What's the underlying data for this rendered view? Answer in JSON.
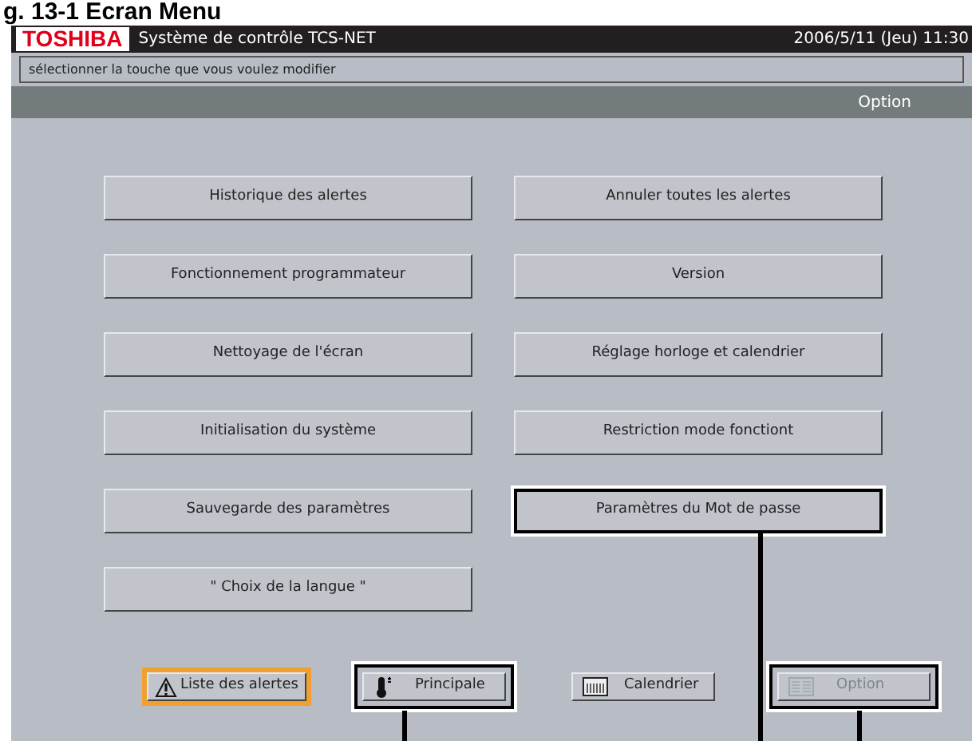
{
  "figure_caption": "g. 13-1 Ecran Menu",
  "header": {
    "logo": "TOSHIBA",
    "title": "Système de contrôle TCS-NET",
    "datetime": "2006/5/11 (Jeu) 11:30"
  },
  "message": "sélectionner la touche que vous voulez modifier",
  "section_title": "Option",
  "menu_buttons": [
    {
      "label": "Historique des alertes",
      "callout": false
    },
    {
      "label": "Annuler toutes les alertes",
      "callout": false
    },
    {
      "label": "Fonctionnement programmateur",
      "callout": false
    },
    {
      "label": "Version",
      "callout": false
    },
    {
      "label": "Nettoyage de l'écran",
      "callout": false
    },
    {
      "label": "Réglage horloge et calendrier",
      "callout": false
    },
    {
      "label": "Initialisation du système",
      "callout": false
    },
    {
      "label": "Restriction mode fonctiont",
      "callout": false
    },
    {
      "label": "Sauvegarde des paramètres",
      "callout": false
    },
    {
      "label": "Paramètres du Mot de passe",
      "callout": true
    },
    {
      "label": "\" Choix de la langue \"",
      "callout": false
    }
  ],
  "nav_buttons": [
    {
      "kind": "alert",
      "label": "Liste des alertes",
      "alert": true,
      "disabled": false,
      "callout": false
    },
    {
      "kind": "main",
      "label": "Principale",
      "alert": false,
      "disabled": false,
      "callout": true
    },
    {
      "kind": "calendar",
      "label": "Calendrier",
      "alert": false,
      "disabled": false,
      "callout": false
    },
    {
      "kind": "option",
      "label": "Option",
      "alert": false,
      "disabled": true,
      "callout": true
    }
  ]
}
